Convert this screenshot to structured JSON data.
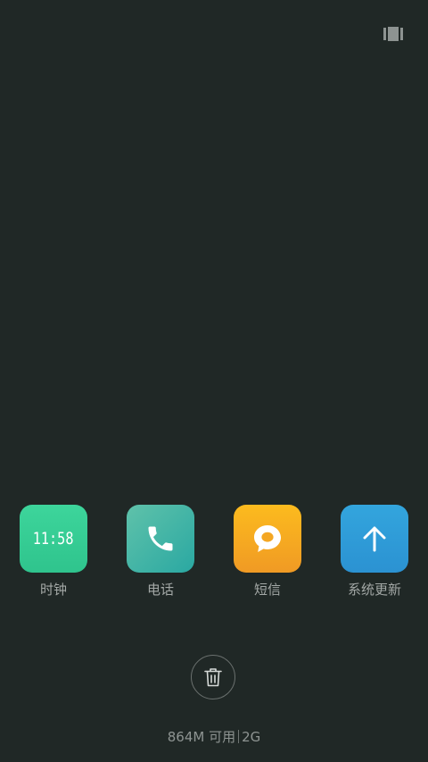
{
  "toolbar": {
    "view_toggle_icon": "grid-view-icon"
  },
  "recent_apps": [
    {
      "label": "时钟",
      "icon": "clock-icon",
      "clock_text": "11:58",
      "color": "#33cc94"
    },
    {
      "label": "电话",
      "icon": "phone-icon",
      "color": "#3fb4a6"
    },
    {
      "label": "短信",
      "icon": "message-icon",
      "color": "#f7ab22"
    },
    {
      "label": "系统更新",
      "icon": "arrow-up-icon",
      "color": "#2f9dd8"
    }
  ],
  "clear_button": {
    "icon": "trash-icon"
  },
  "memory": {
    "available": "864M 可用",
    "total": "2G"
  },
  "colors": {
    "background": "#202826",
    "label": "#a3a8a6"
  }
}
